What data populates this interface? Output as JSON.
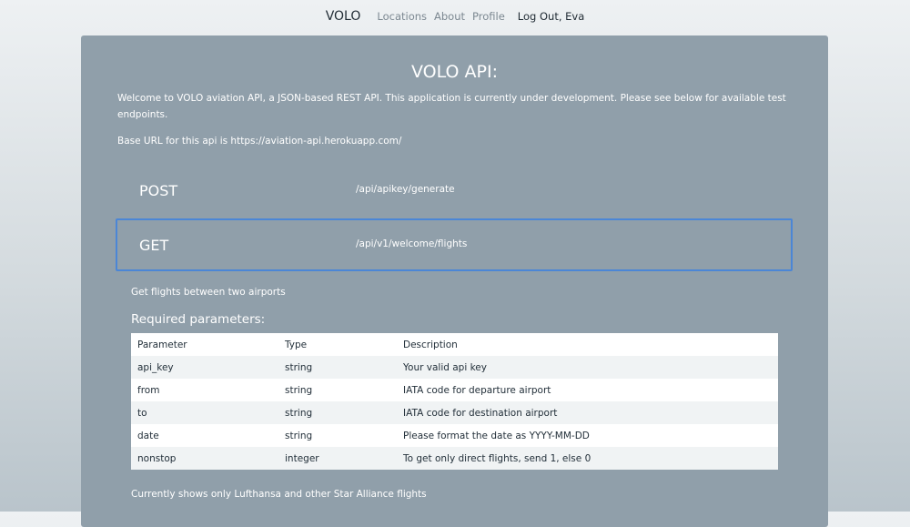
{
  "nav": {
    "brand": "VOLO",
    "links": [
      "Locations",
      "About",
      "Profile"
    ],
    "logout": "Log Out, Eva"
  },
  "main": {
    "title": "VOLO API:",
    "intro": "Welcome to VOLO aviation API, a JSON-based REST API. This application is currently under development. Please see below for available test endpoints.",
    "base_url_text": "Base URL for this api is https://aviation-api.herokuapp.com/",
    "endpoints": [
      {
        "method": "POST",
        "path": "/api/apikey/generate"
      },
      {
        "method": "GET",
        "path": "/api/v1/welcome/flights"
      }
    ],
    "description": "Get flights between two airports",
    "required_heading": "Required parameters:",
    "table": {
      "headers": [
        "Parameter",
        "Type",
        "Description"
      ],
      "rows": [
        [
          "api_key",
          "string",
          "Your valid api key"
        ],
        [
          "from",
          "string",
          "IATA code for departure airport"
        ],
        [
          "to",
          "string",
          "IATA code for destination airport"
        ],
        [
          "date",
          "string",
          "Please format the date as YYYY-MM-DD"
        ],
        [
          "nonstop",
          "integer",
          "To get only direct flights, send 1, else 0"
        ]
      ]
    },
    "footnote": "Currently shows only Lufthansa and other Star Alliance flights"
  },
  "colors": {
    "panel": "#909faa",
    "active_border": "#4b86d6",
    "nav_text": "#1f2a33",
    "nav_link": "#7c8891"
  }
}
